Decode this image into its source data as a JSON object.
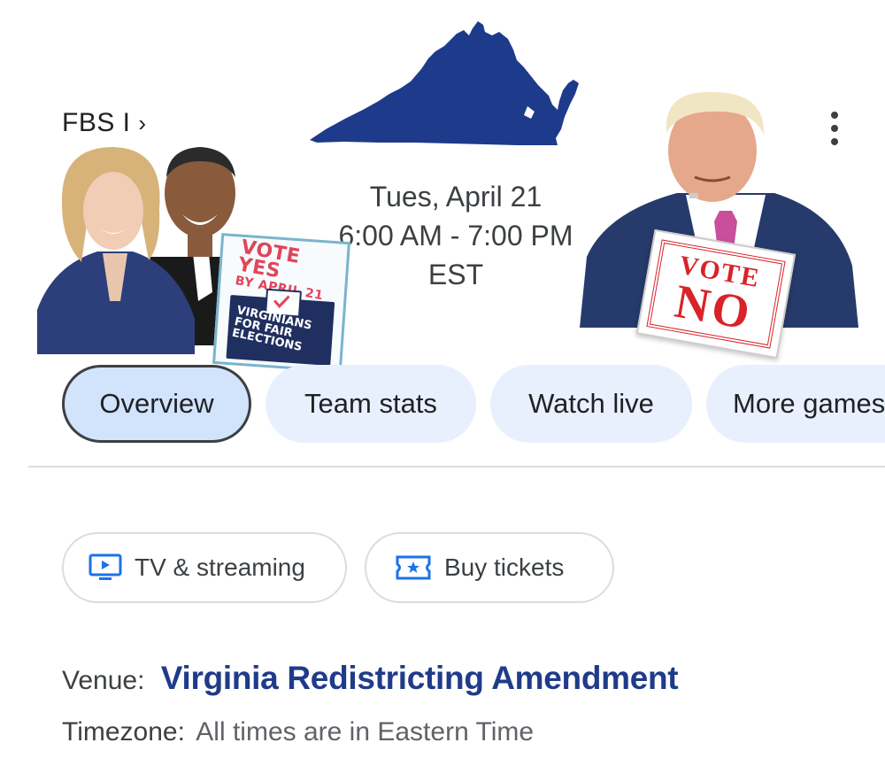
{
  "header": {
    "league": "FBS I",
    "league_chevron": "›",
    "more_icon": "more-vertical-icon"
  },
  "event": {
    "date": "Tues, April 21",
    "time": "6:00 AM - 7:00 PM",
    "timezone": "EST"
  },
  "home_sign": {
    "line1": "VOTE YES",
    "line2": "BY APRIL 21",
    "org_line1": "VIRGINIANS",
    "org_line2": "FOR FAIR",
    "org_line3": "ELECTIONS",
    "accent": "#e0455a",
    "box_color": "#1f2f5f"
  },
  "away_sign": {
    "line1": "VOTE",
    "line2": "NO",
    "color": "#d8232a"
  },
  "tabs": [
    {
      "label": "Overview",
      "active": true
    },
    {
      "label": "Team stats",
      "active": false
    },
    {
      "label": "Watch live",
      "active": false
    },
    {
      "label": "More games",
      "active": false
    }
  ],
  "chips": {
    "tv": {
      "label": "TV & streaming",
      "icon": "tv-icon"
    },
    "tickets": {
      "label": "Buy tickets",
      "icon": "ticket-icon"
    }
  },
  "info": {
    "venue_label": "Venue:",
    "venue_value": "Virginia Redistricting Amendment",
    "timezone_label": "Timezone:",
    "timezone_value": "All times are in Eastern Time"
  },
  "colors": {
    "map": "#1e3a8a",
    "tab_bg": "#e8f0fe",
    "tab_active_bg": "#d2e3fc",
    "venue": "#1f3b8a",
    "icon_blue": "#1a73e8"
  }
}
